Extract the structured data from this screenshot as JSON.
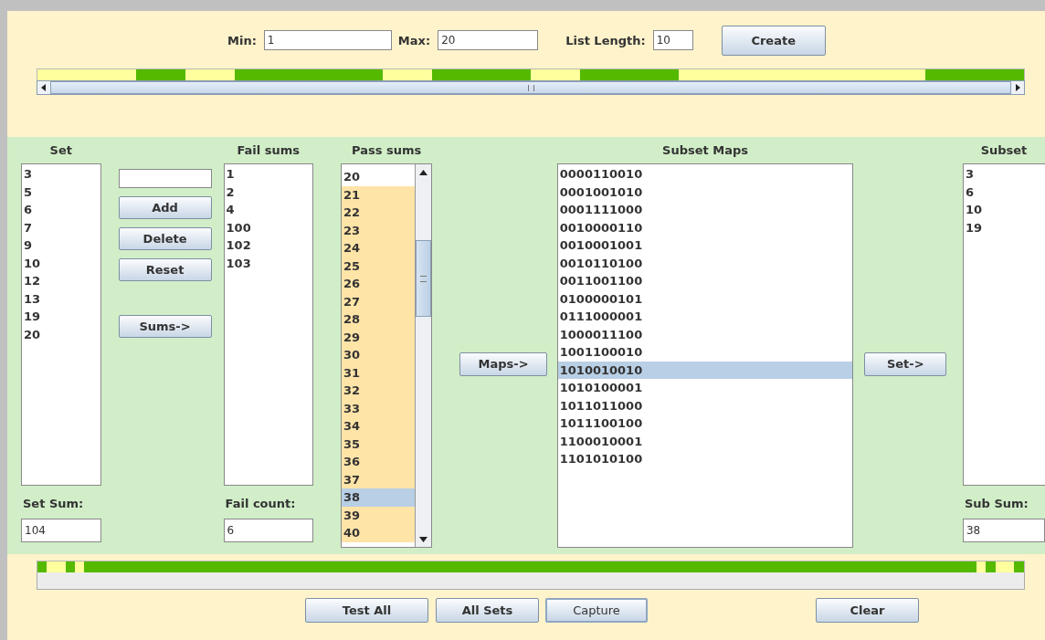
{
  "range_fields": [
    {
      "label": "Min:",
      "value": "1"
    },
    {
      "label": "Max:",
      "value": "20"
    },
    {
      "label": "List Length:",
      "value": "10"
    }
  ],
  "create_button": "Create",
  "set_strip": [
    false,
    false,
    true,
    false,
    true,
    true,
    true,
    false,
    true,
    true,
    false,
    true,
    true,
    false,
    false,
    false,
    false,
    false,
    true,
    true
  ],
  "set": {
    "title": "Set",
    "items": [
      "3",
      "5",
      "6",
      "7",
      "9",
      "10",
      "12",
      "13",
      "19",
      "20"
    ]
  },
  "edit_buttons": [
    "Add",
    "Delete",
    "Reset"
  ],
  "sums_button": "Sums->",
  "set_sum": {
    "label": "Set Sum:",
    "value": "104"
  },
  "fail_sums": {
    "title": "Fail sums",
    "items": [
      "1",
      "2",
      "4",
      "100",
      "102",
      "103"
    ]
  },
  "fail_count": {
    "label": "Fail count:",
    "value": "6"
  },
  "pass_sums": {
    "title": "Pass sums",
    "items": [
      {
        "text": "20",
        "highlighted": false,
        "selected": false
      },
      {
        "text": "21",
        "highlighted": true,
        "selected": false
      },
      {
        "text": "22",
        "highlighted": true,
        "selected": false
      },
      {
        "text": "23",
        "highlighted": true,
        "selected": false
      },
      {
        "text": "24",
        "highlighted": true,
        "selected": false
      },
      {
        "text": "25",
        "highlighted": true,
        "selected": false
      },
      {
        "text": "26",
        "highlighted": true,
        "selected": false
      },
      {
        "text": "27",
        "highlighted": true,
        "selected": false
      },
      {
        "text": "28",
        "highlighted": true,
        "selected": false
      },
      {
        "text": "29",
        "highlighted": true,
        "selected": false
      },
      {
        "text": "30",
        "highlighted": true,
        "selected": false
      },
      {
        "text": "31",
        "highlighted": true,
        "selected": false
      },
      {
        "text": "32",
        "highlighted": true,
        "selected": false
      },
      {
        "text": "33",
        "highlighted": true,
        "selected": false
      },
      {
        "text": "34",
        "highlighted": true,
        "selected": false
      },
      {
        "text": "35",
        "highlighted": true,
        "selected": false
      },
      {
        "text": "36",
        "highlighted": true,
        "selected": false
      },
      {
        "text": "37",
        "highlighted": true,
        "selected": false
      },
      {
        "text": "38",
        "highlighted": true,
        "selected": true
      },
      {
        "text": "39",
        "highlighted": true,
        "selected": false
      },
      {
        "text": "40",
        "highlighted": true,
        "selected": false
      }
    ]
  },
  "maps_button": "Maps->",
  "subset_maps": {
    "title": "Subset Maps",
    "items": [
      {
        "text": "0000110010",
        "selected": false
      },
      {
        "text": "0001001010",
        "selected": false
      },
      {
        "text": "0001111000",
        "selected": false
      },
      {
        "text": "0010000110",
        "selected": false
      },
      {
        "text": "0010001001",
        "selected": false
      },
      {
        "text": "0010110100",
        "selected": false
      },
      {
        "text": "0011001100",
        "selected": false
      },
      {
        "text": "0100000101",
        "selected": false
      },
      {
        "text": "0111000001",
        "selected": false
      },
      {
        "text": "1000011100",
        "selected": false
      },
      {
        "text": "1001100010",
        "selected": false
      },
      {
        "text": "1010010010",
        "selected": true
      },
      {
        "text": "1010100001",
        "selected": false
      },
      {
        "text": "1011011000",
        "selected": false
      },
      {
        "text": "1011100100",
        "selected": false
      },
      {
        "text": "1100010001",
        "selected": false
      },
      {
        "text": "1101010100",
        "selected": false
      }
    ]
  },
  "set_button": "Set->",
  "subset": {
    "title": "Subset",
    "items": [
      "3",
      "6",
      "10",
      "19"
    ]
  },
  "sub_sum": {
    "label": "Sub Sum:",
    "value": "38"
  },
  "sum_strip": [
    true,
    false,
    false,
    true,
    false,
    true,
    true,
    true,
    true,
    true,
    true,
    true,
    true,
    true,
    true,
    true,
    true,
    true,
    true,
    true,
    true,
    true,
    true,
    true,
    true,
    true,
    true,
    true,
    true,
    true,
    true,
    true,
    true,
    true,
    true,
    true,
    true,
    true,
    true,
    true,
    true,
    true,
    true,
    true,
    true,
    true,
    true,
    true,
    true,
    true,
    true,
    true,
    true,
    true,
    true,
    true,
    true,
    true,
    true,
    true,
    true,
    true,
    true,
    true,
    true,
    true,
    true,
    true,
    true,
    true,
    true,
    true,
    true,
    true,
    true,
    true,
    true,
    true,
    true,
    true,
    true,
    true,
    true,
    true,
    true,
    true,
    true,
    true,
    true,
    true,
    true,
    true,
    true,
    true,
    true,
    true,
    true,
    true,
    true,
    true,
    false,
    true,
    false,
    false,
    true
  ],
  "bottom_buttons": [
    {
      "label": "Test All",
      "focused": false
    },
    {
      "label": "All Sets",
      "focused": false
    },
    {
      "label": "Capture",
      "focused": true
    },
    {
      "label": "Clear",
      "focused": false
    }
  ]
}
